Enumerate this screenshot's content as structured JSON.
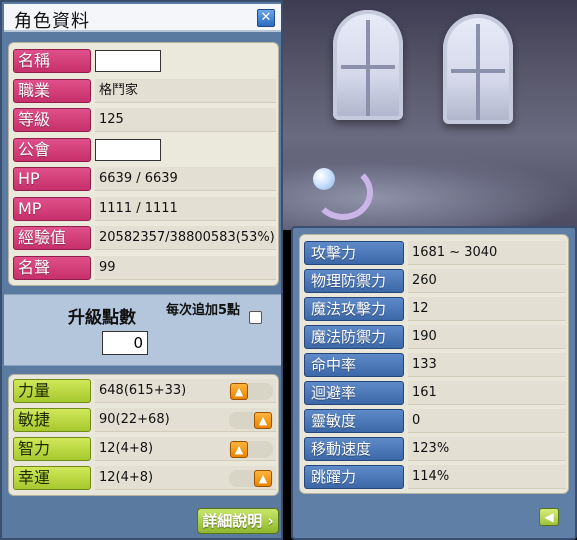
{
  "window": {
    "title": "角色資料",
    "close_icon": "close-x-icon"
  },
  "profile": [
    {
      "key": "name",
      "label": "名稱",
      "value": "",
      "blank_box": true
    },
    {
      "key": "job",
      "label": "職業",
      "value": "格鬥家",
      "blank_box": false
    },
    {
      "key": "level",
      "label": "等級",
      "value": "125",
      "blank_box": false
    },
    {
      "key": "guild",
      "label": "公會",
      "value": "",
      "blank_box": true
    },
    {
      "key": "hp",
      "label": "HP",
      "value": "6639 / 6639",
      "blank_box": false
    },
    {
      "key": "mp",
      "label": "MP",
      "value": "1111 / 1111",
      "blank_box": false
    },
    {
      "key": "exp",
      "label": "經驗值",
      "value": "20582357/38800583(53%)",
      "blank_box": false
    },
    {
      "key": "fame",
      "label": "名聲",
      "value": "99",
      "blank_box": false
    }
  ],
  "ap": {
    "label": "升級點數",
    "value": "0",
    "auto_label": "每次追加5點",
    "auto_checked": false
  },
  "stats": [
    {
      "key": "str",
      "label": "力量",
      "value": "648(615+33)",
      "plus_position": "left"
    },
    {
      "key": "dex",
      "label": "敏捷",
      "value": "90(22+68)",
      "plus_position": "right"
    },
    {
      "key": "int",
      "label": "智力",
      "value": "12(4+8)",
      "plus_position": "left"
    },
    {
      "key": "luk",
      "label": "幸運",
      "value": "12(4+8)",
      "plus_position": "right"
    }
  ],
  "detail_button": {
    "label": "詳細說明"
  },
  "details": [
    {
      "key": "attack",
      "label": "攻擊力",
      "value": "1681 ~ 3040"
    },
    {
      "key": "weapon_def",
      "label": "物理防禦力",
      "value": "260"
    },
    {
      "key": "magic_atk",
      "label": "魔法攻擊力",
      "value": "12"
    },
    {
      "key": "magic_def",
      "label": "魔法防禦力",
      "value": "190"
    },
    {
      "key": "accuracy",
      "label": "命中率",
      "value": "133"
    },
    {
      "key": "avoid",
      "label": "迴避率",
      "value": "161"
    },
    {
      "key": "hands",
      "label": "靈敏度",
      "value": "0"
    },
    {
      "key": "speed",
      "label": "移動速度",
      "value": "123%"
    },
    {
      "key": "jump",
      "label": "跳躍力",
      "value": "114%"
    }
  ],
  "colors": {
    "profile_label": "#d43d7a",
    "stat_label": "#b8d640",
    "detail_label": "#4d7ab8",
    "window_frame": "#5a7aa0"
  }
}
